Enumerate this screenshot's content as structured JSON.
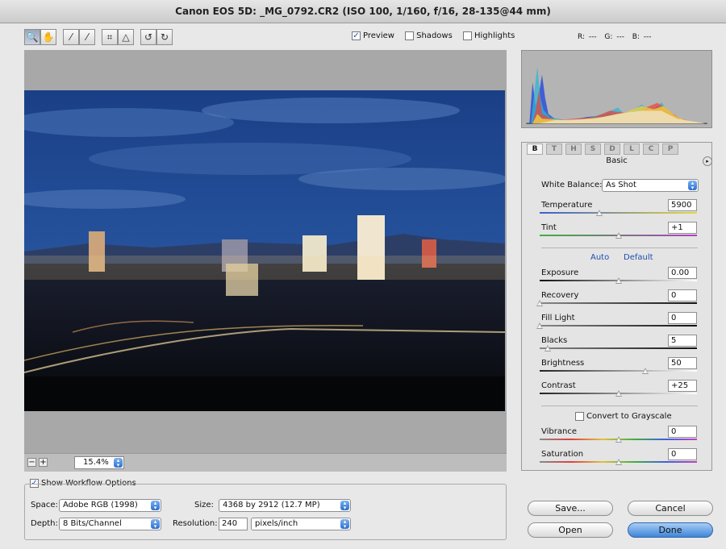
{
  "window": {
    "title": "Canon EOS 5D: _MG_0792.CR2 (ISO 100, 1/160, f/16, 28-135@44 mm)"
  },
  "toolbar": {
    "tools": [
      {
        "name": "zoom-tool-icon",
        "glyph": "🔍"
      },
      {
        "name": "hand-tool-icon",
        "glyph": "✋"
      },
      {
        "name": "white-balance-tool-icon",
        "glyph": "⁄"
      },
      {
        "name": "color-sampler-tool-icon",
        "glyph": "⁄"
      },
      {
        "name": "crop-tool-icon",
        "glyph": "⌗"
      },
      {
        "name": "straighten-tool-icon",
        "glyph": "△"
      },
      {
        "name": "rotate-ccw-icon",
        "glyph": "↺"
      },
      {
        "name": "rotate-cw-icon",
        "glyph": "↻"
      }
    ],
    "preview": {
      "label": "Preview",
      "checked": true
    },
    "shadows": {
      "label": "Shadows",
      "checked": false
    },
    "highlights": {
      "label": "Highlights",
      "checked": false
    },
    "rgb_readout": {
      "r": "R: ---",
      "g": "G: ---",
      "b": "B: ---"
    }
  },
  "zoom": {
    "minus": "−",
    "plus": "+",
    "value": "15.4%"
  },
  "tabs": [
    {
      "label": "B",
      "active": true
    },
    {
      "label": "T",
      "active": false
    },
    {
      "label": "H",
      "active": false
    },
    {
      "label": "S",
      "active": false
    },
    {
      "label": "D",
      "active": false
    },
    {
      "label": "L",
      "active": false
    },
    {
      "label": "C",
      "active": false
    },
    {
      "label": "P",
      "active": false
    }
  ],
  "panel": {
    "title": "Basic",
    "white_balance": {
      "label": "White Balance:",
      "value": "As Shot"
    },
    "auto": "Auto",
    "default": "Default",
    "sliders": [
      {
        "label": "Temperature",
        "value": "5900",
        "level": 0.38,
        "gradient": "linear-gradient(90deg,#3a5fd0,#e6d640)"
      },
      {
        "label": "Tint",
        "value": "+1",
        "level": 0.5,
        "gradient": "linear-gradient(90deg,#3fb040,#b040c0)"
      },
      {
        "label": "Exposure",
        "value": "0.00",
        "level": 0.5,
        "gradient": "linear-gradient(90deg,#111,#fff)"
      },
      {
        "label": "Recovery",
        "value": "0",
        "level": 0.0,
        "gradient": "linear-gradient(90deg,#888,#111)"
      },
      {
        "label": "Fill Light",
        "value": "0",
        "level": 0.0,
        "gradient": "linear-gradient(90deg,#888,#111)"
      },
      {
        "label": "Blacks",
        "value": "5",
        "level": 0.05,
        "gradient": "linear-gradient(90deg,#888,#111)"
      },
      {
        "label": "Brightness",
        "value": "50",
        "level": 0.67,
        "gradient": "linear-gradient(90deg,#222,#fff)"
      },
      {
        "label": "Contrast",
        "value": "+25",
        "level": 0.5,
        "gradient": "linear-gradient(90deg,#222,#fff)"
      },
      {
        "label": "Vibrance",
        "value": "0",
        "level": 0.5,
        "gradient": "linear-gradient(90deg,#888,#e04040,#e0c040,#40b040,#4060e0,#c040c0)"
      },
      {
        "label": "Saturation",
        "value": "0",
        "level": 0.5,
        "gradient": "linear-gradient(90deg,#888,#e04040,#e0c040,#40b040,#4060e0,#c040c0)"
      }
    ],
    "grayscale": {
      "label": "Convert to Grayscale",
      "checked": false
    }
  },
  "workflow": {
    "toggle_label": "Show Workflow Options",
    "checked": true,
    "space_label": "Space:",
    "space_value": "Adobe RGB (1998)",
    "depth_label": "Depth:",
    "depth_value": "8 Bits/Channel",
    "size_label": "Size:",
    "size_value": "4368 by 2912 (12.7 MP)",
    "resolution_label": "Resolution:",
    "resolution_value": "240",
    "resolution_unit": "pixels/inch"
  },
  "buttons": {
    "save": "Save...",
    "cancel": "Cancel",
    "open": "Open",
    "done": "Done"
  },
  "colors": {
    "accent": "#3d85d9",
    "link": "#1c4fb0"
  }
}
